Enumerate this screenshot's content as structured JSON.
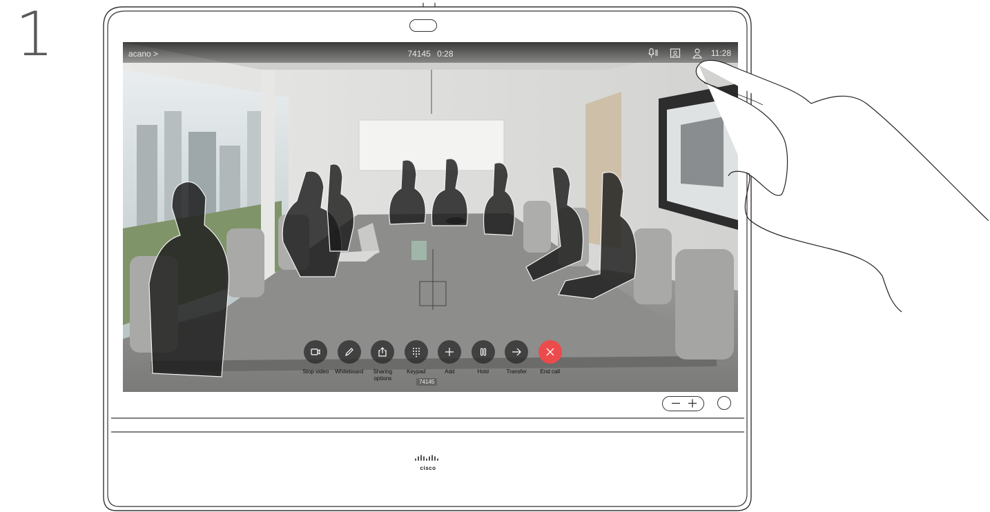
{
  "step_number": "1",
  "status_bar": {
    "left_label": "acano >",
    "call_number": "74145",
    "call_duration": "0:28",
    "icons": [
      "mic-mute-icon",
      "selfview-icon",
      "participants-icon"
    ],
    "time": "11:28"
  },
  "controls": [
    {
      "name": "stop-video",
      "icon": "video-camera-icon",
      "label": "Stop video"
    },
    {
      "name": "whiteboard",
      "icon": "pencil-icon",
      "label": "Whiteboard"
    },
    {
      "name": "sharing-options",
      "icon": "share-icon",
      "label": "Sharing\noptions"
    },
    {
      "name": "keypad",
      "icon": "keypad-icon",
      "label": "Keypad"
    },
    {
      "name": "add",
      "icon": "plus-icon",
      "label": "Add"
    },
    {
      "name": "hold",
      "icon": "pause-icon",
      "label": "Hold"
    },
    {
      "name": "transfer",
      "icon": "arrow-right-icon",
      "label": "Transfer"
    },
    {
      "name": "end-call",
      "icon": "close-icon",
      "label": "End call",
      "color": "#ec4b4b"
    }
  ],
  "call_badge": "74145",
  "brand": {
    "wordmark": "cisco"
  }
}
